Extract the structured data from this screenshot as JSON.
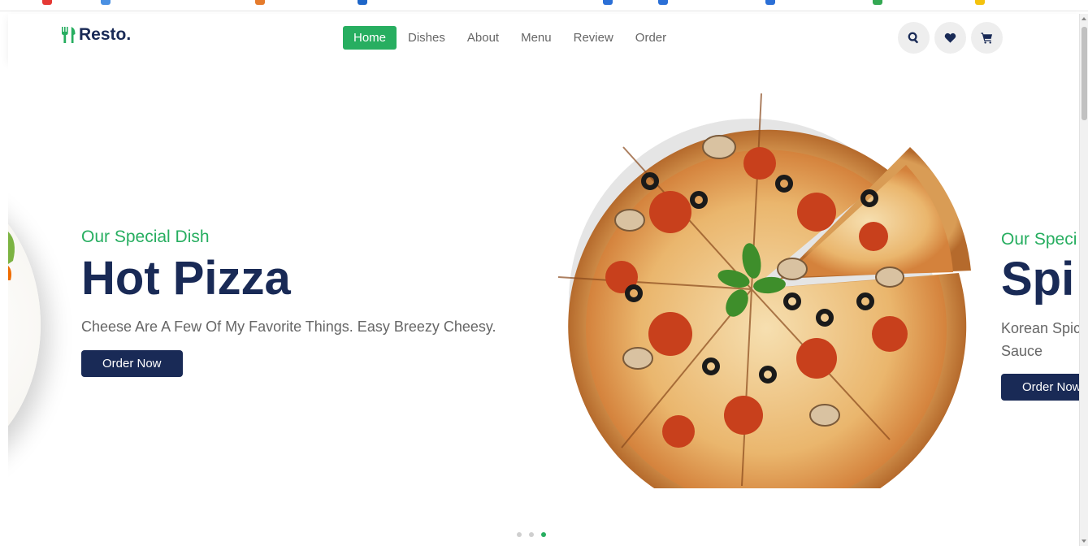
{
  "brand": {
    "name": "Resto.",
    "accent_color": "#27ae60",
    "primary_color": "#192a56",
    "logo_icon": "utensils-icon"
  },
  "nav": {
    "items": [
      {
        "label": "Home",
        "active": true
      },
      {
        "label": "Dishes",
        "active": false
      },
      {
        "label": "About",
        "active": false
      },
      {
        "label": "Menu",
        "active": false
      },
      {
        "label": "Review",
        "active": false
      },
      {
        "label": "Order",
        "active": false
      }
    ]
  },
  "header_icons": [
    "search-icon",
    "heart-icon",
    "cart-icon"
  ],
  "slides": {
    "current": {
      "subtitle": "Our Special Dish",
      "title": "Hot Pizza",
      "description": "Cheese Are A Few Of My Favorite Things. Easy Breezy Cheesy.",
      "button_label": "Order Now"
    },
    "next": {
      "subtitle": "Our Speci",
      "title": "Spi",
      "description": "Korean Spic Sauce",
      "button_label": "Order Now"
    }
  },
  "pagination": {
    "total": 3,
    "active_index": 2
  }
}
